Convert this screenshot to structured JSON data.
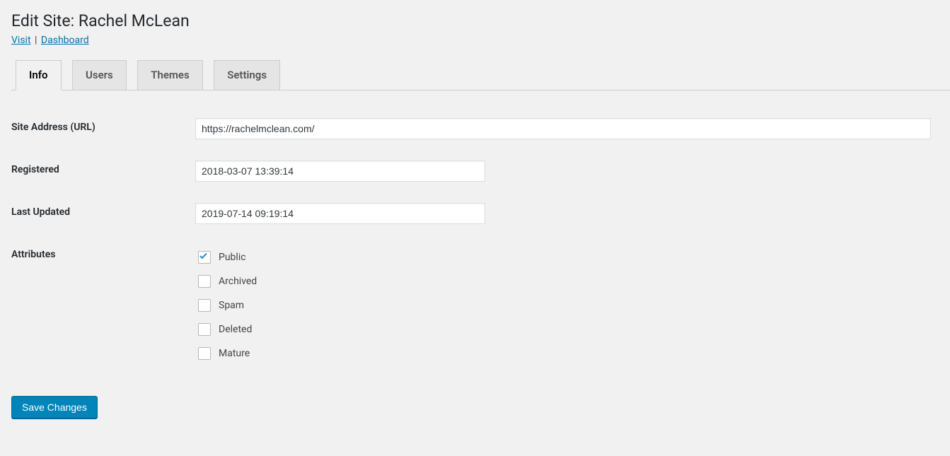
{
  "page_title": "Edit Site: Rachel McLean",
  "links": {
    "visit": "Visit",
    "dashboard": "Dashboard"
  },
  "tabs": [
    {
      "label": "Info",
      "active": true
    },
    {
      "label": "Users",
      "active": false
    },
    {
      "label": "Themes",
      "active": false
    },
    {
      "label": "Settings",
      "active": false
    }
  ],
  "fields": {
    "site_address_label": "Site Address (URL)",
    "site_address_value": "https://rachelmclean.com/",
    "registered_label": "Registered",
    "registered_value": "2018-03-07 13:39:14",
    "last_updated_label": "Last Updated",
    "last_updated_value": "2019-07-14 09:19:14",
    "attributes_label": "Attributes"
  },
  "attributes": [
    {
      "label": "Public",
      "checked": true
    },
    {
      "label": "Archived",
      "checked": false
    },
    {
      "label": "Spam",
      "checked": false
    },
    {
      "label": "Deleted",
      "checked": false
    },
    {
      "label": "Mature",
      "checked": false
    }
  ],
  "buttons": {
    "save": "Save Changes"
  }
}
